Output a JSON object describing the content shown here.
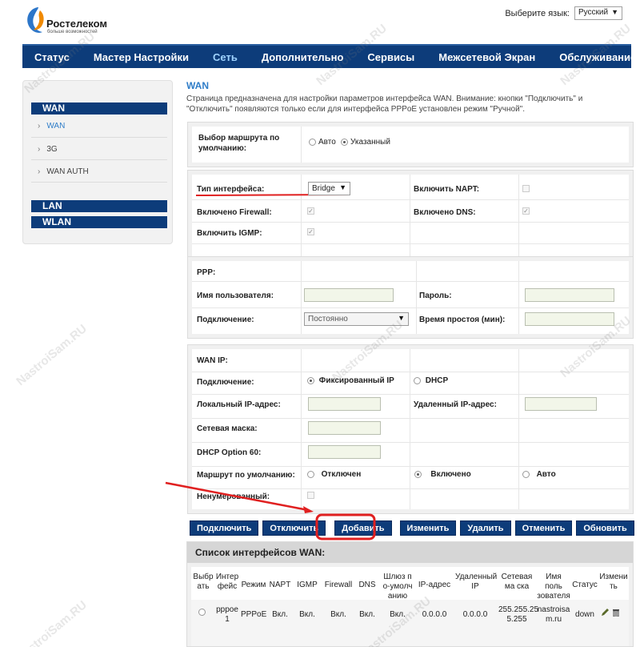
{
  "logo": {
    "name": "Ростелеком",
    "tagline": "больше возможностей"
  },
  "language": {
    "label": "Выберите язык:",
    "value": "Русский"
  },
  "nav": [
    {
      "label": "Статус",
      "active": false
    },
    {
      "label": "Мастер Настройки",
      "active": false
    },
    {
      "label": "Сеть",
      "active": true
    },
    {
      "label": "Дополнительно",
      "active": false
    },
    {
      "label": "Сервисы",
      "active": false
    },
    {
      "label": "Межсетевой Экран",
      "active": false
    },
    {
      "label": "Обслуживание",
      "active": false
    }
  ],
  "sidebar": {
    "wan_header": "WAN",
    "items": [
      {
        "label": "WAN",
        "active": true
      },
      {
        "label": "3G",
        "active": false
      },
      {
        "label": "WAN AUTH",
        "active": false
      }
    ],
    "lan_header": "LAN",
    "wlan_header": "WLAN"
  },
  "page": {
    "title": "WAN",
    "description": "Страница предназначена для настройки параметров интерфейса WAN. Внимание: кнопки \"Подключить\" и \"Отключить\" появляются только если для интерфейса PPPoE установлен режим \"Ручной\"."
  },
  "route": {
    "label": "Выбор маршрута по умолчанию:",
    "auto": "Авто",
    "specified": "Указанный"
  },
  "iface": {
    "type_label": "Тип интерфейса:",
    "type_value": "Bridge",
    "napt_label": "Включить NAPT:",
    "firewall_label": "Включено Firewall:",
    "dns_label": "Включено DNS:",
    "igmp_label": "Включить IGMP:"
  },
  "ppp": {
    "section": "PPP:",
    "user_label": "Имя пользователя:",
    "pass_label": "Пароль:",
    "conn_label": "Подключение:",
    "conn_value": "Постоянно",
    "idle_label": "Время простоя (мин):"
  },
  "wanip": {
    "section": "WAN IP:",
    "conn_label": "Подключение:",
    "fixed": "Фиксированный IP",
    "dhcp": "DHCP",
    "local_ip_label": "Локальный IP-адрес:",
    "remote_ip_label": "Удаленный IP-адрес:",
    "mask_label": "Сетевая маска:",
    "opt60_label": "DHCP Option 60:",
    "default_route_label": "Маршрут по умолчанию:",
    "off": "Отключен",
    "on": "Включено",
    "auto": "Авто",
    "unnumbered_label": "Ненумерованный:"
  },
  "buttons": [
    "Подключить",
    "Отключить",
    "Добавить",
    "Изменить",
    "Удалить",
    "Отменить",
    "Обновить"
  ],
  "list": {
    "title": "Список интерфейсов WAN:",
    "headers": [
      "Выбр ать",
      "Интер фейс",
      "Режим",
      "NAPT",
      "IGMP",
      "Firewall",
      "DNS",
      "Шлюз п о-умолч анию",
      "IP-адрес",
      "Удаленный IP",
      "Сетевая ма ска",
      "Имя поль зователя",
      "Статус",
      "Измени ть"
    ],
    "row": [
      "",
      "pppoe 1",
      "PPPoE",
      "Вкл.",
      "Вкл.",
      "Вкл.",
      "Вкл.",
      "Вкл.",
      "0.0.0.0",
      "0.0.0.0",
      "255.255.25 5.255",
      "nastroisa m.ru",
      "down",
      ""
    ]
  },
  "watermark": "NastroiSam.RU",
  "colors": {
    "nav_bg": "#0d3c7a",
    "accent": "#2f7dc8",
    "highlight": "#e02020"
  }
}
